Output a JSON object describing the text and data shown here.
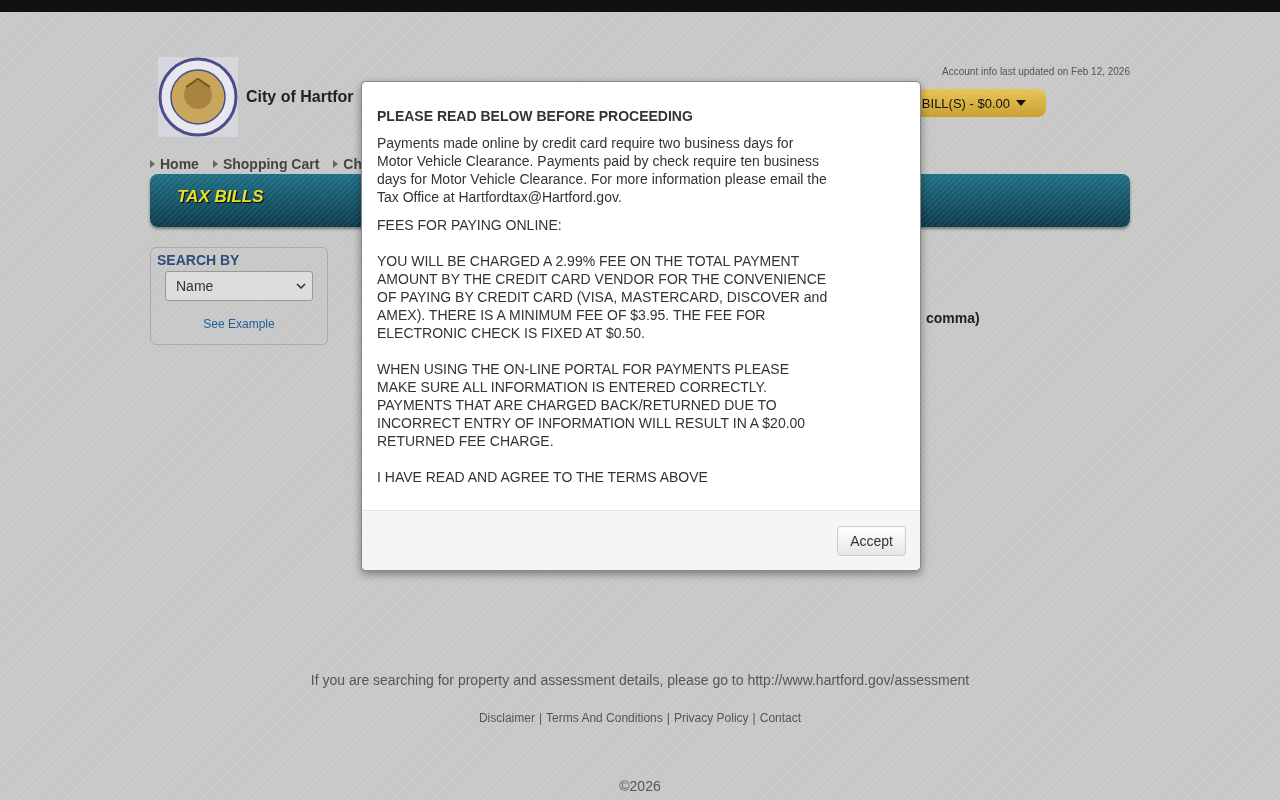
{
  "header": {
    "site_title": "City of Hartfor",
    "account_info": "Account info last updated on Feb 12, 2026",
    "cart_button": "BILL(S) - $0.00"
  },
  "nav": {
    "items": [
      {
        "label": "Home"
      },
      {
        "label": "Shopping Cart"
      },
      {
        "label": "Ch"
      }
    ]
  },
  "banner": {
    "title": "TAX BILLS"
  },
  "search": {
    "label": "SEARCH BY",
    "select_value": "Name",
    "example_link": "See Example"
  },
  "content": {
    "hint_fragment": "comma)"
  },
  "footer": {
    "notice": "If you are searching for property and assessment details, please go to http://www.hartford.gov/assessment",
    "links": [
      "Disclaimer",
      "Terms And Conditions",
      "Privacy Policy",
      "Contact"
    ],
    "link_separator": "|",
    "copyright": "©2026"
  },
  "modal": {
    "heading": "PLEASE READ BELOW BEFORE PROCEEDING",
    "paragraphs": [
      "Payments made online by credit card require two business days for Motor Vehicle Clearance. Payments paid by check require ten business days for Motor Vehicle Clearance. For more information please email the Tax Office at Hartfordtax@Hartford.gov.",
      "FEES FOR PAYING ONLINE:",
      "YOU WILL BE CHARGED A 2.99% FEE ON THE TOTAL PAYMENT AMOUNT BY THE CREDIT CARD VENDOR FOR THE CONVENIENCE OF PAYING BY CREDIT CARD (VISA, MASTERCARD, DISCOVER and AMEX). THERE IS A MINIMUM FEE OF $3.95. THE FEE FOR ELECTRONIC CHECK IS FIXED AT $0.50.",
      "WHEN USING THE ON-LINE PORTAL FOR PAYMENTS PLEASE MAKE SURE ALL INFORMATION IS ENTERED CORRECTLY. PAYMENTS THAT ARE CHARGED BACK/RETURNED DUE TO INCORRECT ENTRY OF INFORMATION WILL RESULT IN A $20.00 RETURNED FEE CHARGE.",
      "I HAVE READ AND AGREE TO THE TERMS ABOVE"
    ],
    "button": "Accept"
  }
}
